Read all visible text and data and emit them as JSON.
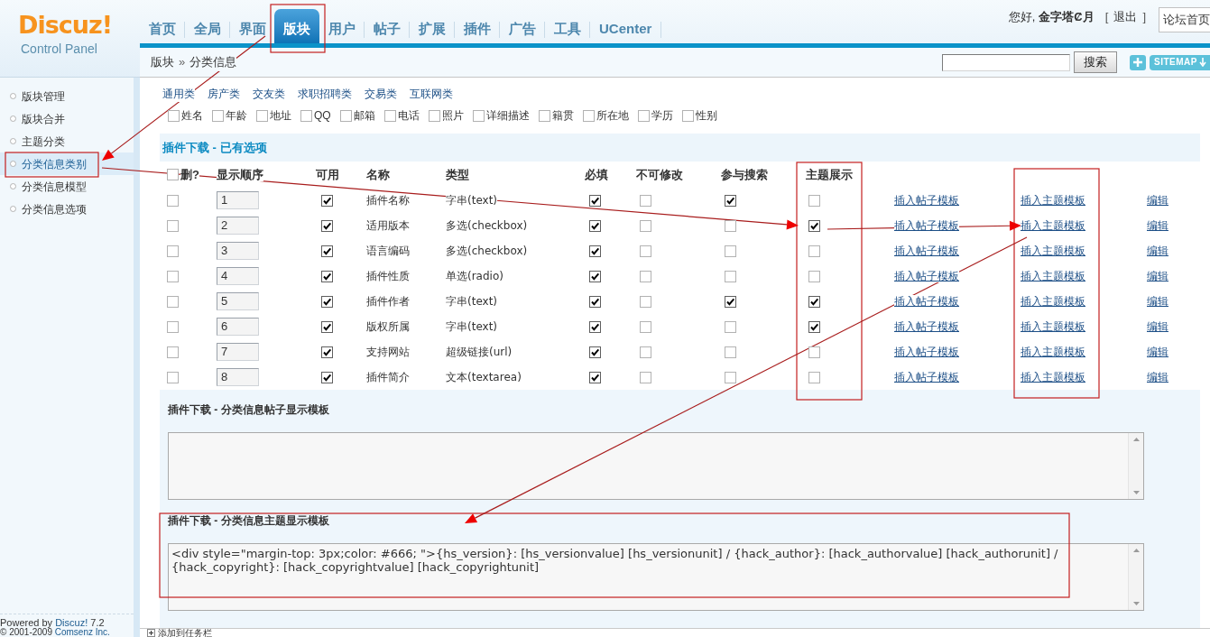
{
  "logo": {
    "name": "Discuz!",
    "subtitle": "Control Panel"
  },
  "nav_tabs": [
    {
      "label": "首页",
      "selected": false
    },
    {
      "label": "全局",
      "selected": false
    },
    {
      "label": "界面",
      "selected": false
    },
    {
      "label": "版块",
      "selected": true
    },
    {
      "label": "用户",
      "selected": false
    },
    {
      "label": "帖子",
      "selected": false
    },
    {
      "label": "扩展",
      "selected": false
    },
    {
      "label": "插件",
      "selected": false
    },
    {
      "label": "广告",
      "selected": false
    },
    {
      "label": "工具",
      "selected": false
    },
    {
      "label": "UCenter",
      "selected": false
    }
  ],
  "user_bar": {
    "greeting": "您好,",
    "username": "金字塔Ȼ月",
    "logout_open": "[",
    "logout": "退出",
    "logout_close": "]",
    "forum_home": "论坛首页"
  },
  "breadcrumb": {
    "items": [
      "版块",
      "分类信息"
    ],
    "separator": "»"
  },
  "search": {
    "button": "搜索"
  },
  "sitemap_button": "SITEMAP",
  "sidebar": {
    "items": [
      {
        "label": "版块管理",
        "selected": false
      },
      {
        "label": "版块合并",
        "selected": false
      },
      {
        "label": "主题分类",
        "selected": false
      },
      {
        "label": "分类信息类别",
        "selected": true
      },
      {
        "label": "分类信息模型",
        "selected": false
      },
      {
        "label": "分类信息选项",
        "selected": false
      }
    ],
    "powered_by": "Powered by",
    "powered_link": "Discuz!",
    "version": "7.2",
    "copyright": "© 2001-2009",
    "copyright_link": "Comsenz Inc."
  },
  "type_categories": [
    "通用类",
    "房产类",
    "交友类",
    "求职招聘类",
    "交易类",
    "互联网类"
  ],
  "field_options": [
    {
      "label": "姓名",
      "checked": false
    },
    {
      "label": "年龄",
      "checked": false
    },
    {
      "label": "地址",
      "checked": false
    },
    {
      "label": "QQ",
      "checked": false
    },
    {
      "label": "邮箱",
      "checked": false
    },
    {
      "label": "电话",
      "checked": false
    },
    {
      "label": "照片",
      "checked": false
    },
    {
      "label": "详细描述",
      "checked": false
    },
    {
      "label": "籍贯",
      "checked": false
    },
    {
      "label": "所在地",
      "checked": false
    },
    {
      "label": "学历",
      "checked": false
    },
    {
      "label": "性别",
      "checked": false
    }
  ],
  "options_section": {
    "title": "插件下载 - 已有选项"
  },
  "table": {
    "select_all_checked": false,
    "columns": [
      "删?",
      "显示顺序",
      "可用",
      "名称",
      "类型",
      "必填",
      "不可修改",
      "参与搜索",
      "主题展示"
    ],
    "rows": [
      {
        "delete": false,
        "order": "1",
        "enabled": true,
        "name": "插件名称",
        "type": "字串(text)",
        "required": true,
        "locked": false,
        "searchable": true,
        "thread_display": false,
        "post_template_link": "插入帖子模板",
        "thread_template_link": "插入主题模板",
        "edit_link": "编辑"
      },
      {
        "delete": false,
        "order": "2",
        "enabled": true,
        "name": "适用版本",
        "type": "多选(checkbox)",
        "required": true,
        "locked": false,
        "searchable": false,
        "thread_display": true,
        "post_template_link": "插入帖子模板",
        "thread_template_link": "插入主题模板",
        "edit_link": "编辑"
      },
      {
        "delete": false,
        "order": "3",
        "enabled": true,
        "name": "语言编码",
        "type": "多选(checkbox)",
        "required": true,
        "locked": false,
        "searchable": false,
        "thread_display": false,
        "post_template_link": "插入帖子模板",
        "thread_template_link": "插入主题模板",
        "edit_link": "编辑"
      },
      {
        "delete": false,
        "order": "4",
        "enabled": true,
        "name": "插件性质",
        "type": "单选(radio)",
        "required": true,
        "locked": false,
        "searchable": false,
        "thread_display": false,
        "post_template_link": "插入帖子模板",
        "thread_template_link": "插入主题模板",
        "edit_link": "编辑"
      },
      {
        "delete": false,
        "order": "5",
        "enabled": true,
        "name": "插件作者",
        "type": "字串(text)",
        "required": true,
        "locked": false,
        "searchable": true,
        "thread_display": true,
        "post_template_link": "插入帖子模板",
        "thread_template_link": "插入主题模板",
        "edit_link": "编辑"
      },
      {
        "delete": false,
        "order": "6",
        "enabled": true,
        "name": "版权所属",
        "type": "字串(text)",
        "required": true,
        "locked": false,
        "searchable": false,
        "thread_display": true,
        "post_template_link": "插入帖子模板",
        "thread_template_link": "插入主题模板",
        "edit_link": "编辑"
      },
      {
        "delete": false,
        "order": "7",
        "enabled": true,
        "name": "支持网站",
        "type": "超级链接(url)",
        "required": true,
        "locked": false,
        "searchable": false,
        "thread_display": false,
        "post_template_link": "插入帖子模板",
        "thread_template_link": "插入主题模板",
        "edit_link": "编辑"
      },
      {
        "delete": false,
        "order": "8",
        "enabled": true,
        "name": "插件简介",
        "type": "文本(textarea)",
        "required": true,
        "locked": false,
        "searchable": false,
        "thread_display": false,
        "post_template_link": "插入帖子模板",
        "thread_template_link": "插入主题模板",
        "edit_link": "编辑"
      }
    ]
  },
  "templates": [
    {
      "title": "插件下载 - 分类信息帖子显示模板"
    },
    {
      "title": "插件下载 - 分类信息主题显示模板",
      "value": "<div style=\"margin-top: 3px;color: #666; \">{hs_version}: [hs_versionvalue] [hs_versionunit] / {hack_author}: [hack_authorvalue] [hack_authorunit] / {hack_copyright}: [hack_copyrightvalue] [hack_copyrightunit]"
    }
  ],
  "taskbar": {
    "label": "添加到任务栏"
  }
}
